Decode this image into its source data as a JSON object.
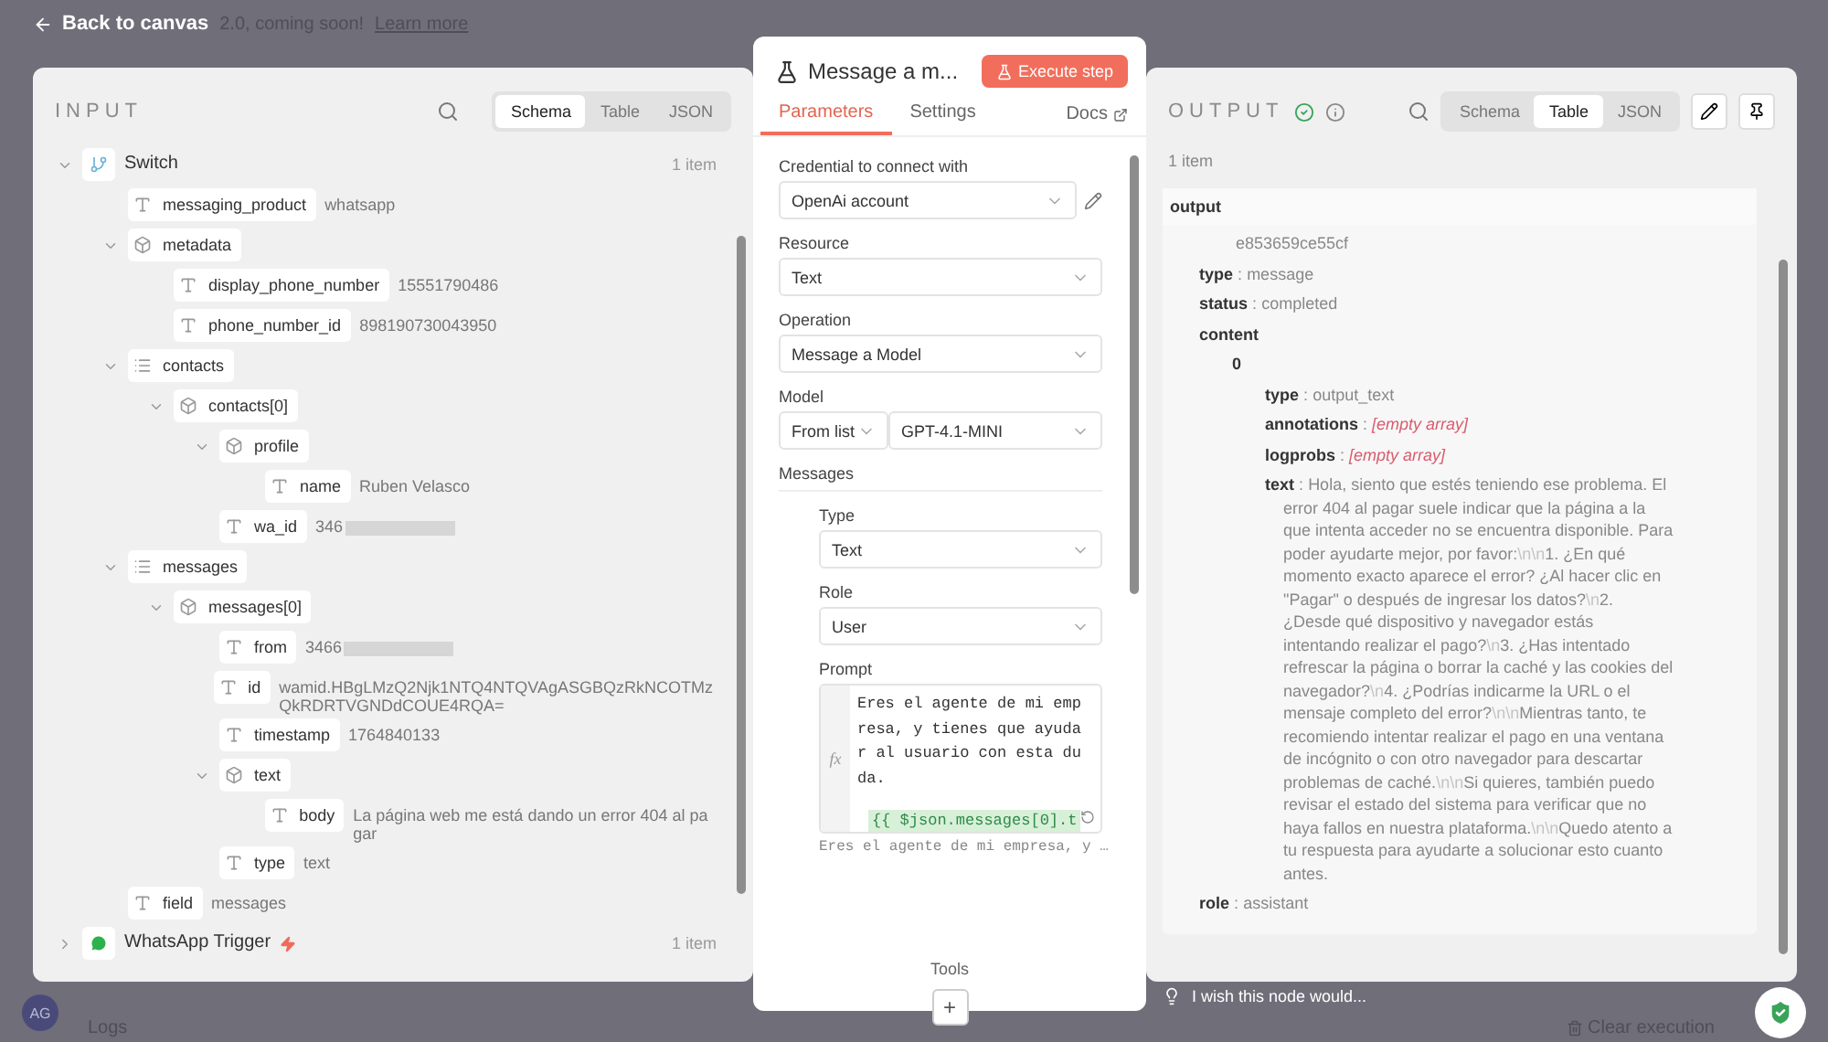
{
  "banner": {
    "text": "2.0, coming soon!",
    "link": "Learn more"
  },
  "back": "Back to canvas",
  "input": {
    "title": "INPUT",
    "views": [
      {
        "label": "Schema",
        "selected": true
      },
      {
        "label": "Table",
        "selected": false
      },
      {
        "label": "JSON",
        "selected": false
      }
    ],
    "tree": [
      {
        "kind": "node",
        "name": "Switch",
        "trigger": false,
        "count": "1 item",
        "expanded": true,
        "children": [
          {
            "kind": "string",
            "name": "messaging_product",
            "value": "whatsapp"
          },
          {
            "kind": "object",
            "name": "metadata",
            "expanded": true,
            "children": [
              {
                "kind": "string",
                "name": "display_phone_number",
                "value": "15551790486"
              },
              {
                "kind": "string",
                "name": "phone_number_id",
                "value": "898190730043950"
              }
            ]
          },
          {
            "kind": "array",
            "name": "contacts",
            "expanded": true,
            "children": [
              {
                "kind": "object",
                "name": "contacts[0]",
                "expanded": true,
                "children": [
                  {
                    "kind": "object",
                    "name": "profile",
                    "expanded": true,
                    "children": [
                      {
                        "kind": "string",
                        "name": "name",
                        "value": "Ruben Velasco"
                      }
                    ]
                  },
                  {
                    "kind": "string",
                    "name": "wa_id",
                    "value": "346",
                    "redacted": true
                  }
                ]
              }
            ]
          },
          {
            "kind": "array",
            "name": "messages",
            "expanded": true,
            "children": [
              {
                "kind": "object",
                "name": "messages[0]",
                "expanded": true,
                "children": [
                  {
                    "kind": "string",
                    "name": "from",
                    "value": "3466",
                    "redacted": true
                  },
                  {
                    "kind": "string",
                    "name": "id",
                    "value": "wamid.HBgLMzQ2Njk1NTQ4NTQVAgASGBQzRkNCOTMzQkRDRTVGNDdCOUE4RQA="
                  },
                  {
                    "kind": "string",
                    "name": "timestamp",
                    "value": "1764840133"
                  },
                  {
                    "kind": "object",
                    "name": "text",
                    "expanded": true,
                    "children": [
                      {
                        "kind": "string",
                        "name": "body",
                        "value": "La página web me está dando un error 404 al pagar"
                      }
                    ]
                  },
                  {
                    "kind": "string",
                    "name": "type",
                    "value": "text"
                  }
                ]
              }
            ]
          },
          {
            "kind": "string",
            "name": "field",
            "value": "messages"
          }
        ]
      },
      {
        "kind": "node",
        "name": "WhatsApp Trigger",
        "trigger": true,
        "count": "1 item",
        "expanded": false
      }
    ]
  },
  "node": {
    "title": "Message a m...",
    "execute": "Execute step",
    "tabs": [
      {
        "label": "Parameters",
        "selected": true
      },
      {
        "label": "Settings",
        "selected": false
      }
    ],
    "docs": "Docs",
    "credential": {
      "label": "Credential to connect with",
      "value": "OpenAi account"
    },
    "resource": {
      "label": "Resource",
      "value": "Text"
    },
    "operation": {
      "label": "Operation",
      "value": "Message a Model"
    },
    "model": {
      "label": "Model",
      "mode": "From list",
      "value": "GPT-4.1-MINI"
    },
    "messages": {
      "label": "Messages",
      "type": {
        "label": "Type",
        "value": "Text"
      },
      "role": {
        "label": "Role",
        "value": "User"
      },
      "prompt": {
        "label": "Prompt",
        "fx": "fx",
        "text": "Eres el agente de mi empresa, y tienes que ayudar al usuario con esta duda.",
        "expression": "{{ $json.messages[0].t",
        "preview": "Eres el agente de mi empresa, y …"
      }
    },
    "tools": "Tools",
    "add": "+"
  },
  "output": {
    "title": "OUTPUT",
    "success": true,
    "views": [
      {
        "label": "Schema",
        "selected": false
      },
      {
        "label": "Table",
        "selected": true
      },
      {
        "label": "JSON",
        "selected": false
      }
    ],
    "count": "1 item",
    "header": "output",
    "separator": ":",
    "items": [
      {
        "kind": "plain",
        "value": "e853659ce55cf"
      },
      {
        "kind": "pair",
        "key": "type",
        "value": "message"
      },
      {
        "kind": "pair",
        "key": "status",
        "value": "completed"
      },
      {
        "kind": "group",
        "key": "content",
        "children": [
          {
            "kind": "group",
            "key": "0",
            "children": [
              {
                "kind": "pair",
                "key": "type",
                "value": "output_text"
              },
              {
                "kind": "empty",
                "key": "annotations",
                "value": "[empty array]"
              },
              {
                "kind": "empty",
                "key": "logprobs",
                "value": "[empty array]"
              },
              {
                "kind": "pair",
                "key": "text",
                "value": "Hola, siento que estés teniendo ese problema. El error 404 al pagar suele indicar que la página a la que intenta acceder no se encuentra disponible. Para poder ayudarte mejor, por favor:\\n\\n1. ¿En qué momento exacto aparece el error? ¿Al hacer clic en \"Pagar\" o después de ingresar los datos?\\n2. ¿Desde qué dispositivo y navegador estás intentando realizar el pago?\\n3. ¿Has intentado refrescar la página o borrar la caché y las cookies del navegador?\\n4. ¿Podrías indicarme la URL o el mensaje completo del error?\\n\\nMientras tanto, te recomiendo intentar realizar el pago en una ventana de incógnito o con otro navegador para descartar problemas de caché.\\n\\nSi quieres, también puedo revisar el estado del sistema para verificar que no haya fallos en nuestra plataforma.\\n\\nQuedo atento a tu respuesta para ayudarte a solucionar esto cuanto antes."
              }
            ]
          }
        ]
      },
      {
        "kind": "pair",
        "key": "role",
        "value": "assistant"
      }
    ],
    "feedback": "I wish this node would..."
  },
  "footer": {
    "avatar": "AG",
    "logs": "Logs",
    "clear": "Clear execution"
  }
}
